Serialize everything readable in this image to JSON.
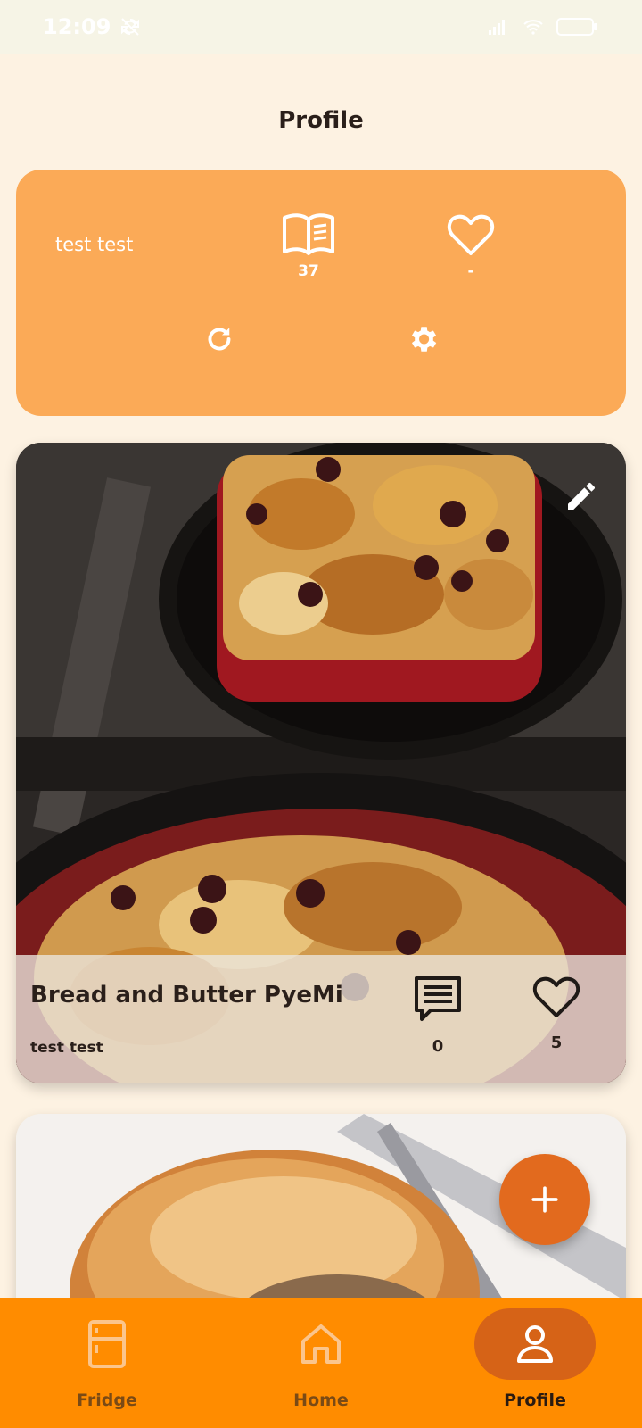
{
  "status_bar": {
    "time": "12:09",
    "battery": "100"
  },
  "header": {
    "title": "Profile"
  },
  "profile": {
    "name": "test test",
    "recipes_count": "37",
    "likes_count": "-"
  },
  "recipes": [
    {
      "title": "Bread and Butter PyeMi",
      "author": "test test",
      "comments": "0",
      "likes": "5"
    },
    {
      "title": "",
      "author": ""
    }
  ],
  "nav": {
    "items": [
      {
        "label": "Fridge",
        "icon": "fridge-icon"
      },
      {
        "label": "Home",
        "icon": "home-icon"
      },
      {
        "label": "Profile",
        "icon": "person-icon",
        "active": true
      }
    ]
  },
  "colors": {
    "background": "#fdf2e2",
    "card": "#fbaa57",
    "nav": "#ff8c00",
    "active_pill": "#d66317",
    "fab": "#e26a1e"
  }
}
